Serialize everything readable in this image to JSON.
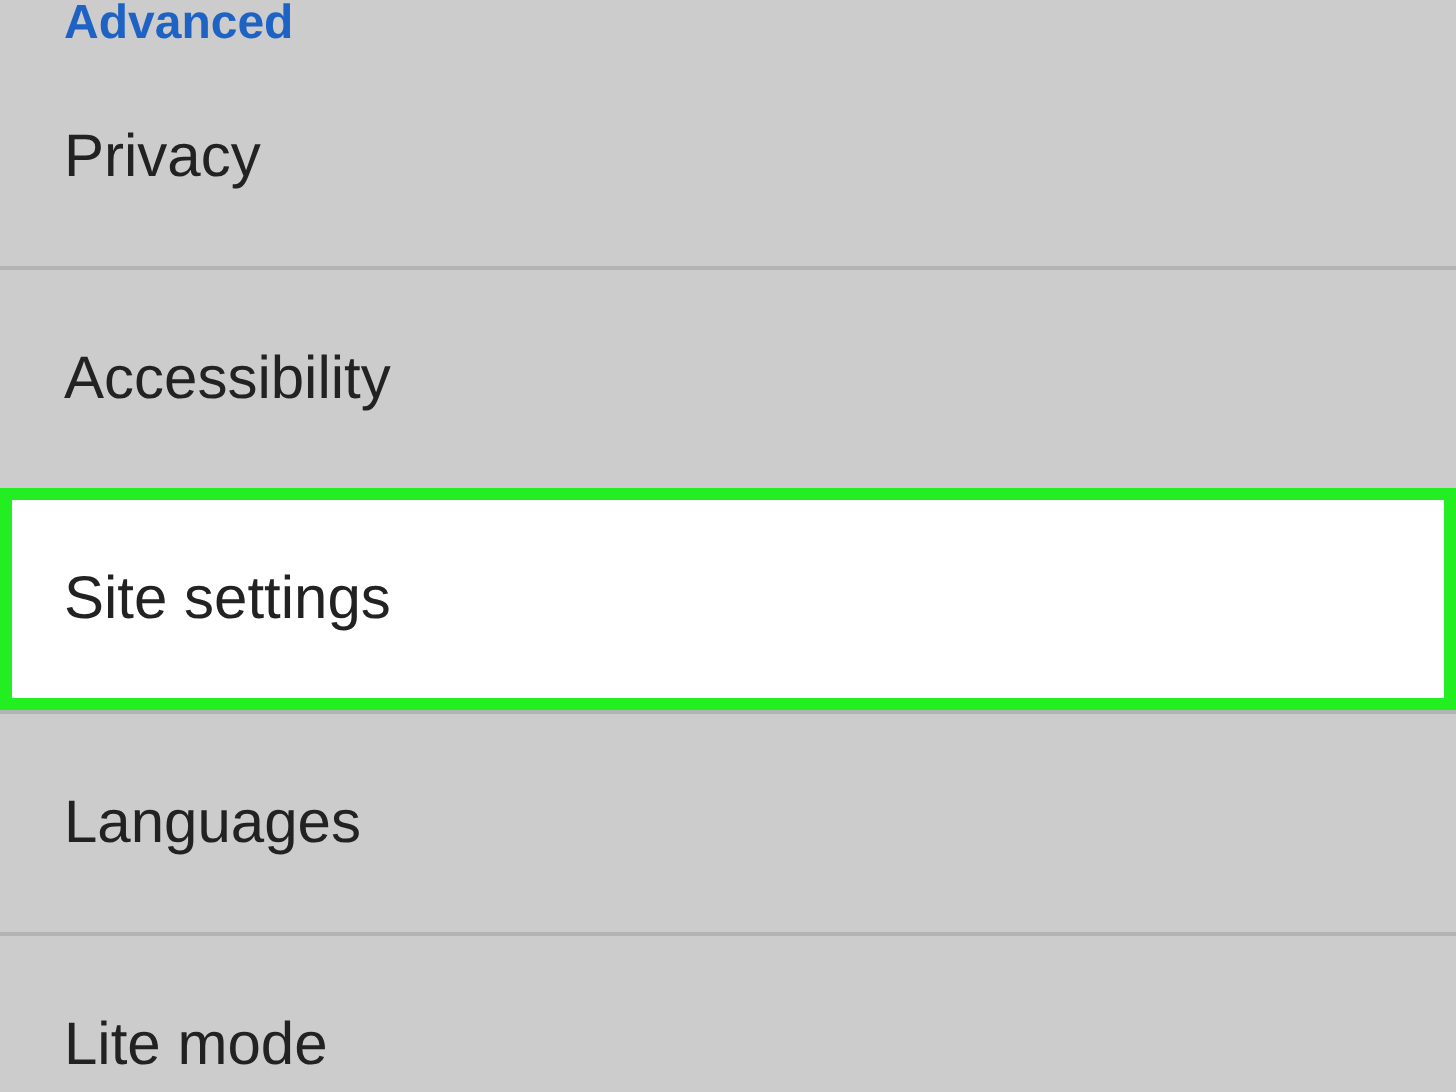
{
  "section_header": "Advanced",
  "items": [
    {
      "label": "Privacy",
      "selected": false
    },
    {
      "label": "Accessibility",
      "selected": false
    },
    {
      "label": "Site settings",
      "selected": true
    },
    {
      "label": "Languages",
      "selected": false
    },
    {
      "label": "Lite mode",
      "selected": false
    }
  ]
}
